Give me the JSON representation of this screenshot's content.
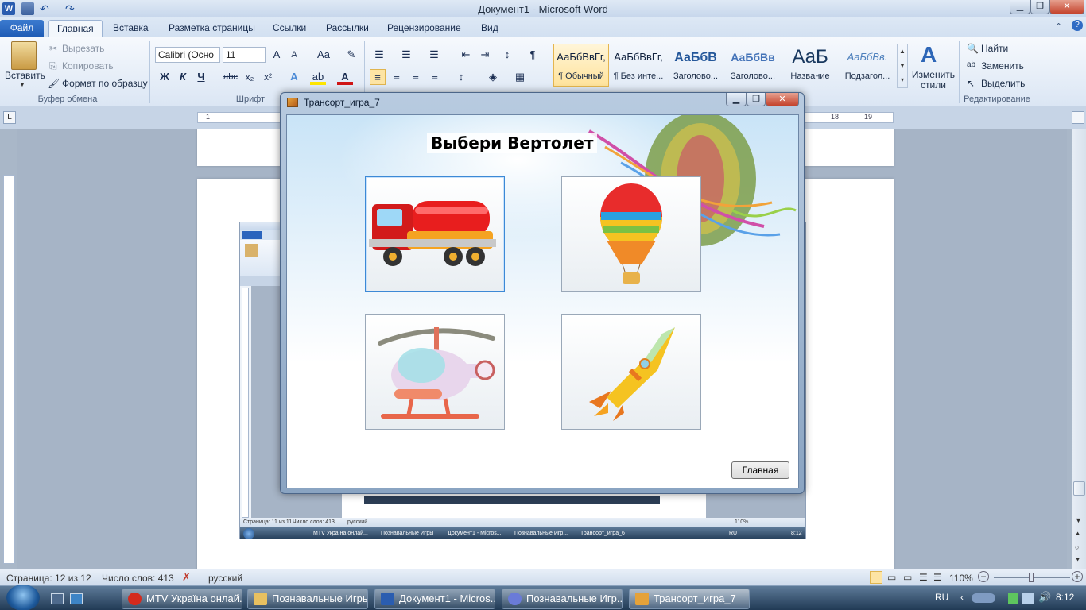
{
  "word": {
    "title": "Документ1  -  Microsoft Word",
    "tabs": [
      "Файл",
      "Главная",
      "Вставка",
      "Разметка страницы",
      "Ссылки",
      "Рассылки",
      "Рецензирование",
      "Вид"
    ],
    "clipboard": {
      "paste": "Вставить",
      "cut": "Вырезать",
      "copy": "Копировать",
      "format_painter": "Формат по образцу",
      "label": "Буфер обмена"
    },
    "font": {
      "name": "Calibri (Осно",
      "size": "11",
      "label": "Шрифт",
      "bold": "Ж",
      "italic": "К",
      "underline": "Ч",
      "strike": "abc"
    },
    "styles": [
      {
        "sample": "АаБбВвГг,",
        "name": "¶ Обычный"
      },
      {
        "sample": "АаБбВвГг,",
        "name": "¶ Без инте..."
      },
      {
        "sample": "АаБбВ",
        "name": "Заголово..."
      },
      {
        "sample": "АаБбВв",
        "name": "Заголово..."
      },
      {
        "sample": "АаБ",
        "name": "Название"
      },
      {
        "sample": "АаБбВв.",
        "name": "Подзагол..."
      }
    ],
    "change_styles": "Изменить стили",
    "editing": {
      "find": "Найти",
      "replace": "Заменить",
      "select": "Выделить",
      "label": "Редактирование"
    },
    "ruler_left": [
      "1"
    ],
    "ruler_right": [
      "18",
      "19"
    ],
    "status": {
      "page": "Страница: 12 из 12",
      "words": "Число слов: 413",
      "lang": "русский",
      "zoom": "110%"
    }
  },
  "dialog": {
    "title": "Трансорт_игра_7",
    "heading": "Выбери Вертолет",
    "cards": [
      "tanker-truck",
      "hot-air-balloon",
      "helicopter",
      "rocket"
    ],
    "button": "Главная"
  },
  "embed": {
    "status_page": "Страница: 11 из 11",
    "status_words": "Число слов: 413",
    "status_lang": "русский",
    "tasks": [
      "MTV Україна онлай...",
      "Познавальные Игры",
      "Документ1 - Micros...",
      "Познавальные Игр...",
      "Трансорт_игра_6"
    ],
    "time": "8:12",
    "lang": "RU",
    "zoom": "110%"
  },
  "taskbar": {
    "tasks": [
      "MTV Україна онлай...",
      "Познавальные Игры",
      "Документ1 - Micros...",
      "Познавальные Игр...",
      "Трансорт_игра_7"
    ],
    "lang": "RU",
    "time": "8:12"
  },
  "colors": {
    "accent": "#1e5bb5",
    "taskbar": "#213a55",
    "dialog_frame": "#8aa4c2"
  }
}
